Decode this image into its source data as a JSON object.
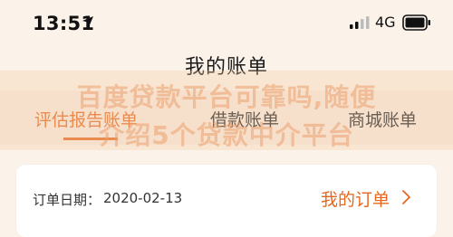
{
  "status": {
    "time": "13:51",
    "network": "4G"
  },
  "header": {
    "title": "我的账单"
  },
  "tabs": [
    {
      "label": "评估报告账单",
      "active": true
    },
    {
      "label": "借款账单",
      "active": false
    },
    {
      "label": "商城账单",
      "active": false
    }
  ],
  "watermark": {
    "line1": "百度贷款平台可靠吗,随便",
    "line2": "介绍5个贷款中介平台"
  },
  "order": {
    "date_label": "订单日期：",
    "date_value": "2020-02-13",
    "link_label": "我的订单"
  },
  "colors": {
    "accent": "#e4681f",
    "background": "#fbf3ea"
  }
}
